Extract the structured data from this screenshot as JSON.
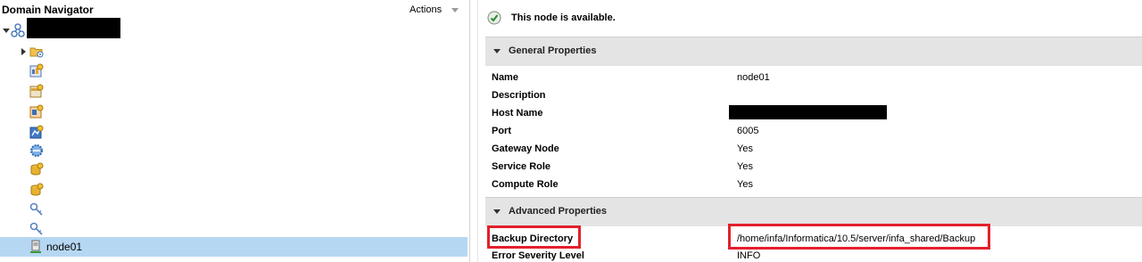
{
  "navigator": {
    "title": "Domain Navigator",
    "actions_label": "Actions",
    "selected_node": "node01"
  },
  "tree": {
    "icons": [
      "domain-icon",
      "folder-icon",
      "service-icon",
      "service-icon",
      "service-icon",
      "service-icon",
      "gear-service-icon",
      "database-icon",
      "database-icon",
      "key-icon",
      "key-icon",
      "node-icon"
    ]
  },
  "status": {
    "message": "This node is available."
  },
  "general": {
    "header": "General Properties",
    "rows": [
      {
        "label": "Name",
        "value": "node01"
      },
      {
        "label": "Description",
        "value": ""
      },
      {
        "label": "Host Name",
        "value": ""
      },
      {
        "label": "Port",
        "value": "6005"
      },
      {
        "label": "Gateway Node",
        "value": "Yes"
      },
      {
        "label": "Service Role",
        "value": "Yes"
      },
      {
        "label": "Compute Role",
        "value": "Yes"
      }
    ]
  },
  "advanced": {
    "header": "Advanced Properties",
    "rows": [
      {
        "label": "Backup Directory",
        "value": "/home/infa/Informatica/10.5/server/infa_shared/Backup"
      },
      {
        "label": "Error Severity Level",
        "value": "INFO"
      }
    ]
  },
  "colors": {
    "highlight": "#e3202b",
    "selection": "#b6d7f2",
    "section_bg": "#e4e4e4"
  }
}
